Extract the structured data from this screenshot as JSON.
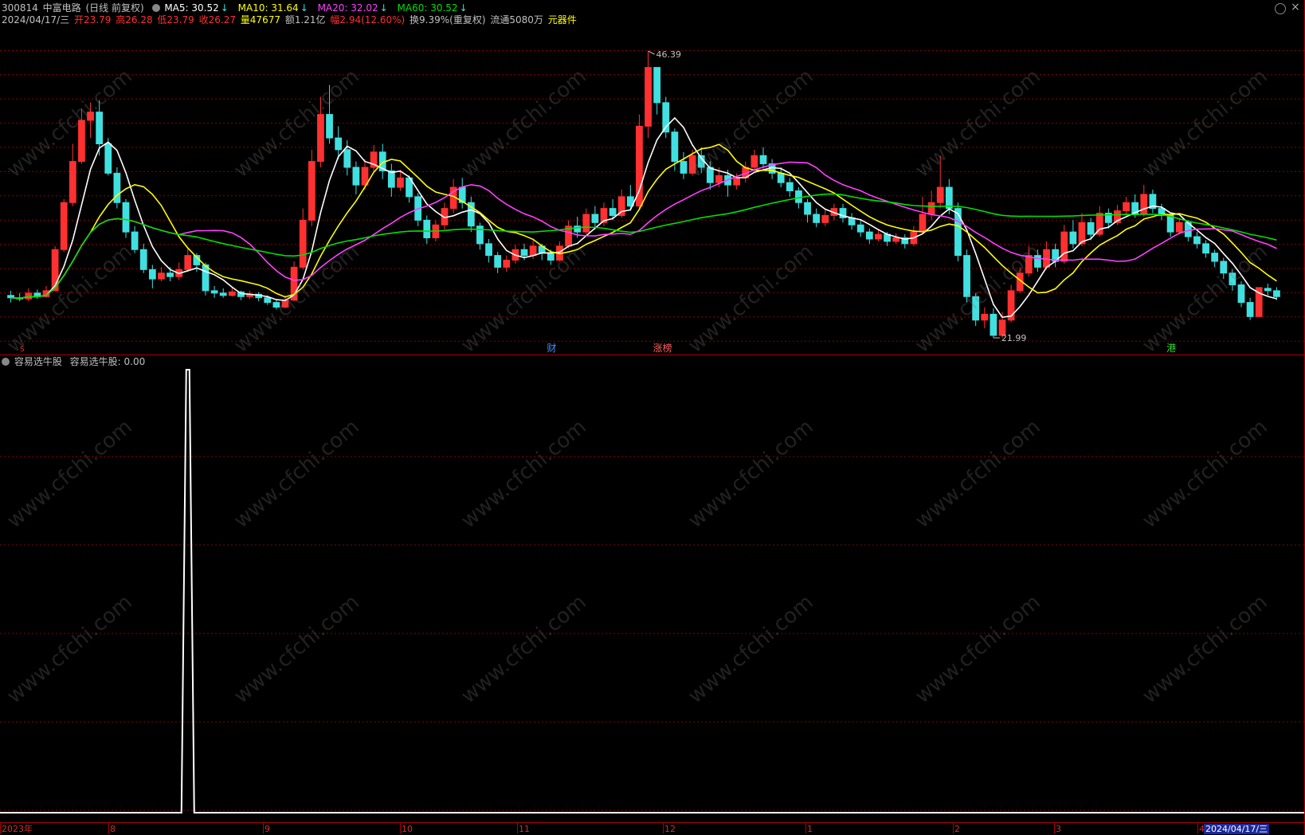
{
  "header": {
    "code": "300814",
    "name": "中富电路",
    "period": "(日线 前复权)",
    "ma": [
      {
        "label": "MA5: 30.52",
        "arrow": "↓",
        "color": "#ffffff"
      },
      {
        "label": "MA10: 31.64",
        "arrow": "↓",
        "color": "#ffff00"
      },
      {
        "label": "MA20: 32.02",
        "arrow": "↓",
        "color": "#ff40ff"
      },
      {
        "label": "MA60: 30.52",
        "arrow": "↓",
        "color": "#00e000"
      }
    ]
  },
  "quote": {
    "date": "2024/04/17/三",
    "open": "开23.79",
    "high": "高26.28",
    "low": "低23.79",
    "close": "收26.27",
    "volume": "量47677",
    "amount": "额1.21亿",
    "change": "幅2.94(12.60%)",
    "turnover": "换9.39%(重复权)",
    "float": "流通5080万",
    "sector": "元器件"
  },
  "annotations": {
    "high_label": "46.39",
    "low_label": "21.99"
  },
  "event_tags": [
    {
      "text": "财",
      "color": "#4090ff"
    },
    {
      "text": "涨榜",
      "color": "#ff6060"
    },
    {
      "text": "港",
      "color": "#30e030"
    }
  ],
  "indicator": {
    "name": "容易选牛股",
    "value_label": "容易选牛股: 0.00"
  },
  "x_axis": {
    "labels": [
      "2023年",
      "8",
      "9",
      "10",
      "11",
      "12",
      "1",
      "2",
      "3",
      "4"
    ],
    "current_date": "2024/04/17/三"
  },
  "watermark": "www.cfchi.com",
  "colors": {
    "up": "#ff3030",
    "down": "#40e0e0",
    "ma5": "#ffffff",
    "ma10": "#ffff00",
    "ma20": "#ff40ff",
    "ma60": "#00e000",
    "grid": "#8b0000"
  },
  "chart_data": {
    "type": "candlestick",
    "price_range": [
      21.99,
      46.39
    ],
    "candles": [
      [
        25.6,
        25.4,
        26.0,
        25.0
      ],
      [
        25.4,
        25.3,
        25.8,
        25.1
      ],
      [
        25.3,
        25.8,
        26.2,
        25.1
      ],
      [
        25.8,
        25.5,
        26.1,
        25.3
      ],
      [
        25.5,
        26.0,
        26.4,
        25.4
      ],
      [
        26.0,
        29.5,
        29.8,
        26.0
      ],
      [
        29.5,
        33.5,
        33.8,
        29.3
      ],
      [
        33.5,
        37.0,
        38.5,
        33.2
      ],
      [
        37.0,
        40.5,
        41.5,
        36.8
      ],
      [
        40.5,
        41.2,
        42.0,
        39.0
      ],
      [
        41.2,
        38.5,
        42.2,
        37.5
      ],
      [
        38.5,
        36.0,
        39.0,
        35.8
      ],
      [
        36.0,
        33.5,
        36.5,
        33.0
      ],
      [
        33.5,
        31.0,
        33.8,
        30.5
      ],
      [
        31.0,
        29.5,
        31.5,
        29.2
      ],
      [
        29.5,
        27.8,
        30.0,
        27.5
      ],
      [
        27.8,
        27.0,
        28.2,
        26.2
      ],
      [
        27.0,
        27.5,
        28.0,
        26.8
      ],
      [
        27.5,
        27.2,
        28.0,
        26.8
      ],
      [
        27.2,
        27.8,
        28.4,
        26.9
      ],
      [
        27.8,
        29.0,
        29.6,
        27.6
      ],
      [
        29.0,
        28.2,
        29.2,
        27.6
      ],
      [
        28.2,
        26.0,
        28.4,
        25.6
      ],
      [
        26.0,
        25.8,
        26.4,
        25.4
      ],
      [
        25.8,
        25.6,
        26.2,
        25.4
      ],
      [
        25.6,
        25.9,
        26.3,
        25.5
      ],
      [
        25.9,
        25.5,
        26.0,
        25.2
      ],
      [
        25.5,
        25.7,
        26.0,
        25.3
      ],
      [
        25.7,
        25.4,
        25.9,
        25.1
      ],
      [
        25.4,
        25.0,
        25.6,
        24.8
      ],
      [
        25.0,
        24.6,
        25.2,
        24.4
      ],
      [
        24.6,
        25.2,
        25.6,
        24.5
      ],
      [
        25.2,
        28.0,
        28.5,
        25.1
      ],
      [
        28.0,
        32.0,
        33.0,
        27.8
      ],
      [
        32.0,
        37.0,
        38.0,
        31.5
      ],
      [
        37.0,
        41.0,
        42.5,
        36.5
      ],
      [
        41.0,
        39.0,
        43.5,
        38.5
      ],
      [
        39.0,
        38.0,
        40.0,
        37.2
      ],
      [
        38.0,
        36.5,
        38.8,
        35.8
      ],
      [
        36.5,
        35.0,
        37.0,
        34.2
      ],
      [
        35.0,
        36.5,
        37.2,
        34.6
      ],
      [
        36.5,
        37.8,
        38.4,
        36.0
      ],
      [
        37.8,
        36.2,
        38.5,
        35.5
      ],
      [
        36.2,
        34.8,
        36.8,
        34.0
      ],
      [
        34.8,
        35.6,
        36.3,
        34.5
      ],
      [
        35.6,
        34.0,
        35.8,
        33.5
      ],
      [
        34.0,
        32.0,
        34.3,
        31.5
      ],
      [
        32.0,
        30.5,
        32.4,
        30.0
      ],
      [
        30.5,
        31.6,
        32.0,
        30.2
      ],
      [
        31.6,
        33.0,
        33.5,
        31.2
      ],
      [
        33.0,
        34.8,
        35.5,
        32.6
      ],
      [
        34.8,
        33.5,
        35.6,
        33.0
      ],
      [
        33.5,
        31.5,
        34.0,
        31.0
      ],
      [
        31.5,
        30.0,
        31.8,
        29.5
      ],
      [
        30.0,
        29.0,
        30.4,
        28.4
      ],
      [
        29.0,
        28.0,
        29.3,
        27.5
      ],
      [
        28.0,
        28.6,
        29.0,
        27.6
      ],
      [
        28.6,
        29.5,
        29.9,
        28.3
      ],
      [
        29.5,
        29.0,
        30.0,
        28.6
      ],
      [
        29.0,
        29.8,
        30.3,
        28.7
      ],
      [
        29.8,
        29.2,
        30.0,
        28.6
      ],
      [
        29.2,
        28.6,
        29.5,
        28.2
      ],
      [
        28.6,
        29.8,
        30.2,
        28.5
      ],
      [
        29.8,
        31.5,
        32.0,
        29.6
      ],
      [
        31.5,
        31.0,
        32.3,
        30.5
      ],
      [
        31.0,
        32.5,
        33.0,
        30.8
      ],
      [
        32.5,
        31.8,
        33.2,
        31.2
      ],
      [
        31.8,
        33.0,
        33.5,
        31.5
      ],
      [
        33.0,
        32.4,
        33.8,
        32.0
      ],
      [
        32.4,
        34.0,
        34.6,
        32.2
      ],
      [
        34.0,
        33.2,
        35.0,
        32.8
      ],
      [
        33.2,
        40.0,
        41.0,
        33.0
      ],
      [
        40.0,
        45.0,
        46.39,
        39.0
      ],
      [
        45.0,
        42.0,
        44.8,
        41.0
      ],
      [
        42.0,
        39.5,
        42.5,
        39.0
      ],
      [
        39.5,
        37.0,
        39.8,
        36.2
      ],
      [
        37.0,
        36.0,
        37.8,
        35.5
      ],
      [
        36.0,
        37.5,
        38.0,
        35.8
      ],
      [
        37.5,
        36.5,
        38.2,
        36.0
      ],
      [
        36.5,
        35.2,
        37.0,
        34.6
      ],
      [
        35.2,
        35.8,
        36.5,
        34.8
      ],
      [
        35.8,
        35.0,
        36.3,
        34.0
      ],
      [
        35.0,
        35.6,
        36.0,
        34.6
      ],
      [
        35.6,
        36.5,
        37.0,
        35.2
      ],
      [
        36.5,
        37.5,
        38.0,
        36.2
      ],
      [
        37.5,
        36.8,
        38.2,
        36.4
      ],
      [
        36.8,
        36.0,
        37.2,
        35.5
      ],
      [
        36.0,
        35.2,
        36.5,
        34.8
      ],
      [
        35.2,
        34.5,
        35.6,
        34.0
      ],
      [
        34.5,
        33.5,
        34.8,
        33.0
      ],
      [
        33.5,
        32.5,
        33.8,
        31.8
      ],
      [
        32.5,
        31.8,
        33.0,
        31.4
      ],
      [
        31.8,
        32.4,
        32.9,
        31.5
      ],
      [
        32.4,
        33.0,
        33.4,
        32.0
      ],
      [
        33.0,
        32.2,
        33.4,
        31.8
      ],
      [
        32.2,
        31.6,
        32.6,
        31.2
      ],
      [
        31.6,
        31.0,
        32.0,
        30.6
      ],
      [
        31.0,
        30.4,
        31.3,
        30.0
      ],
      [
        30.4,
        30.8,
        31.2,
        30.2
      ],
      [
        30.8,
        30.2,
        31.0,
        29.8
      ],
      [
        30.2,
        30.5,
        30.9,
        30.0
      ],
      [
        30.5,
        30.0,
        30.8,
        29.6
      ],
      [
        30.0,
        31.0,
        31.5,
        29.8
      ],
      [
        31.0,
        32.5,
        34.0,
        30.8
      ],
      [
        32.5,
        33.5,
        34.5,
        32.0
      ],
      [
        33.5,
        34.8,
        37.5,
        33.0
      ],
      [
        34.8,
        33.0,
        35.5,
        32.5
      ],
      [
        33.0,
        29.0,
        33.5,
        28.5
      ],
      [
        29.0,
        25.5,
        29.5,
        25.0
      ],
      [
        25.5,
        23.5,
        25.8,
        23.0
      ],
      [
        23.5,
        24.0,
        24.6,
        22.8
      ],
      [
        24.0,
        22.2,
        24.5,
        21.99
      ],
      [
        22.2,
        23.5,
        24.2,
        22.0
      ],
      [
        23.5,
        26.0,
        26.5,
        23.3
      ],
      [
        26.0,
        27.5,
        28.0,
        25.8
      ],
      [
        27.5,
        29.0,
        29.8,
        27.2
      ],
      [
        29.0,
        28.0,
        29.5,
        27.6
      ],
      [
        28.0,
        29.5,
        30.2,
        27.8
      ],
      [
        29.5,
        28.5,
        30.0,
        28.0
      ],
      [
        28.5,
        31.0,
        31.6,
        28.3
      ],
      [
        31.0,
        30.0,
        32.0,
        29.6
      ],
      [
        30.0,
        31.8,
        32.6,
        29.8
      ],
      [
        31.8,
        30.8,
        32.2,
        30.3
      ],
      [
        30.8,
        32.6,
        33.2,
        30.6
      ],
      [
        32.6,
        31.8,
        33.0,
        31.3
      ],
      [
        31.8,
        32.8,
        33.3,
        31.6
      ],
      [
        32.8,
        33.5,
        34.0,
        32.4
      ],
      [
        33.5,
        32.5,
        34.2,
        32.2
      ],
      [
        32.5,
        34.2,
        35.0,
        32.3
      ],
      [
        34.2,
        33.0,
        34.6,
        32.6
      ],
      [
        33.0,
        32.4,
        33.4,
        32.0
      ],
      [
        32.4,
        31.0,
        32.6,
        30.6
      ],
      [
        31.0,
        31.8,
        32.2,
        30.8
      ],
      [
        31.8,
        30.6,
        32.0,
        30.2
      ],
      [
        30.6,
        30.0,
        31.0,
        29.6
      ],
      [
        30.0,
        29.2,
        30.3,
        28.8
      ],
      [
        29.2,
        28.5,
        29.5,
        28.0
      ],
      [
        28.5,
        27.5,
        28.8,
        27.0
      ],
      [
        27.5,
        26.5,
        27.8,
        26.0
      ],
      [
        26.5,
        25.0,
        26.8,
        24.6
      ],
      [
        25.0,
        23.8,
        25.4,
        23.5
      ],
      [
        23.8,
        26.27,
        26.28,
        23.79
      ],
      [
        26.2,
        26.0,
        26.6,
        25.6
      ],
      [
        26.0,
        25.5,
        26.3,
        25.2
      ]
    ],
    "indicator_signal": {
      "spikes_at_candle_index": [
        20,
        151
      ],
      "value": 0.0
    }
  }
}
